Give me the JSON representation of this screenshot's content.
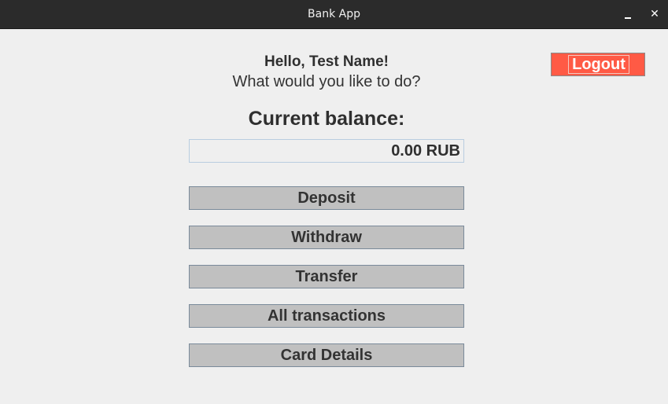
{
  "window": {
    "title": "Bank App",
    "minimize_glyph": "",
    "close_glyph": "✕"
  },
  "header": {
    "greeting": "Hello, Test Name!",
    "prompt": "What would you like to do?"
  },
  "balance": {
    "label": "Current balance:",
    "value": "0.00 RUB"
  },
  "actions": {
    "deposit": "Deposit",
    "withdraw": "Withdraw",
    "transfer": "Transfer",
    "all_transactions": "All transactions",
    "card_details": "Card Details"
  },
  "logout": {
    "label": "Logout",
    "color": "#ff5a45"
  },
  "icons": {
    "minimize": "minimize-icon",
    "close": "close-icon"
  }
}
